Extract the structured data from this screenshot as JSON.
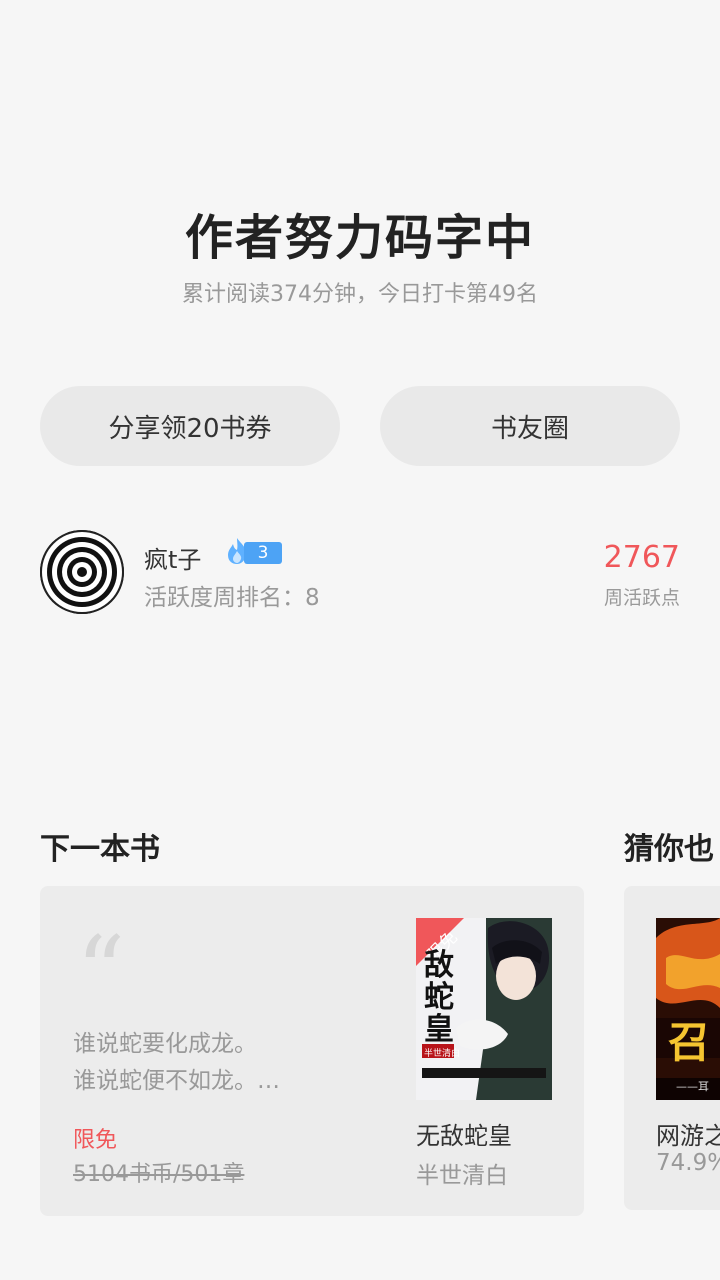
{
  "header": {
    "title": "作者努力码字中",
    "subtitle": "累计阅读374分钟，今日打卡第49名"
  },
  "actions": {
    "share_label": "分享领20书券",
    "circle_label": "书友圈"
  },
  "user": {
    "name": "疯t子",
    "level": "3",
    "rank_text": "活跃度周排名：8",
    "points": "2767",
    "points_label": "周活跃点"
  },
  "next_book": {
    "section_title": "下一本书",
    "quote": "“",
    "excerpt_line1": "谁说蛇要化成龙。",
    "excerpt_line2": "谁说蛇便不如龙。…",
    "free_label": "限免",
    "price": "5104书币/501章",
    "cover_badge": "限免",
    "cover_title": "敌蛇皇",
    "cover_author": "半世清白",
    "title": "无敌蛇皇",
    "author": "半世清白"
  },
  "guess": {
    "section_title": "猜你也",
    "title": "网游之",
    "stat": "74.9%",
    "cover_text": "召",
    "cover_sub": "——耳"
  },
  "colors": {
    "accent": "#f0575a",
    "level_blue": "#4da3f5"
  }
}
